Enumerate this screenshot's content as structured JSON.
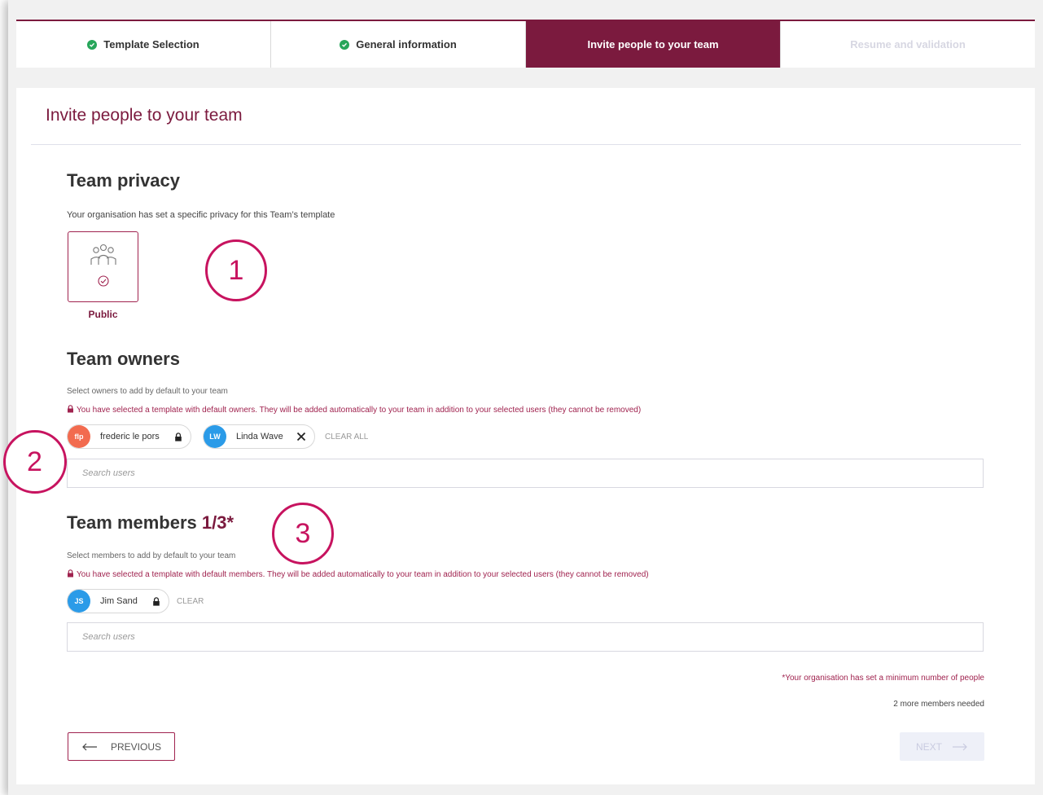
{
  "stepper": {
    "steps": [
      {
        "label": "Template Selection",
        "status": "done"
      },
      {
        "label": "General information",
        "status": "done"
      },
      {
        "label": "Invite people to your team",
        "status": "active"
      },
      {
        "label": "Resume and validation",
        "status": "pending"
      }
    ]
  },
  "page": {
    "title": "Invite people to your team"
  },
  "privacy": {
    "heading": "Team privacy",
    "description": "Your organisation has set a specific privacy for this Team’s template",
    "option_label": "Public"
  },
  "owners": {
    "heading": "Team owners",
    "helper": "Select owners to add by default to your team",
    "notice": "You have selected a template with default owners. They will be added automatically to your team in addition to your selected users (they cannot be removed)",
    "chips": [
      {
        "initials": "flp",
        "name": "frederic le pors",
        "locked": true,
        "color": "#f26b4f"
      },
      {
        "initials": "LW",
        "name": "Linda Wave",
        "locked": false,
        "color": "#2b9be8"
      }
    ],
    "clear_label": "CLEAR ALL",
    "search_placeholder": "Search users"
  },
  "members": {
    "heading": "Team members",
    "count": "1/3*",
    "helper": "Select members to add by default to your team",
    "notice": "You have selected a template with default members. They will be added automatically to your team in addition to your selected users (they cannot be removed)",
    "chips": [
      {
        "initials": "JS",
        "name": "Jim Sand",
        "locked": true,
        "color": "#2b9be8"
      }
    ],
    "clear_label": "CLEAR",
    "search_placeholder": "Search users",
    "minimum_note": "*Your organisation has set a minimum number of people",
    "needed_note": "2 more members needed"
  },
  "annotations": [
    "1",
    "2",
    "3"
  ],
  "nav": {
    "previous_label": "PREVIOUS",
    "next_label": "NEXT"
  },
  "colors": {
    "brand": "#7b1a3e",
    "accent": "#a0234f",
    "annotation": "#c7135f",
    "success": "#27a65a"
  }
}
